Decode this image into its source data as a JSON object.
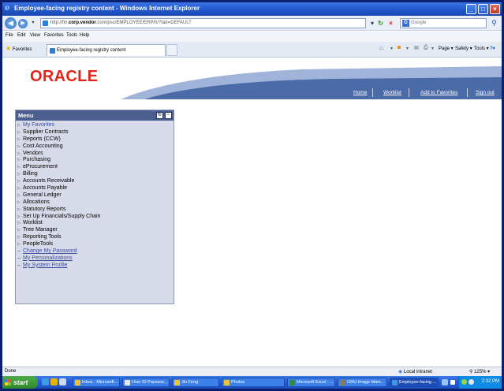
{
  "window": {
    "title": "Employee-facing registry content - Windows Internet Explorer"
  },
  "address": {
    "url_prefix": "http://fin.",
    "url_domain": "corp.vendor",
    "url_suffix": ".com/psc/EMPLOYEE/ERP/h/?tab=DEFAULT",
    "search_placeholder": "Google"
  },
  "menubar": {
    "items": [
      "File",
      "Edit",
      "View",
      "Favorites",
      "Tools",
      "Help"
    ]
  },
  "favorites": {
    "favorites_label": "Favorites",
    "tab_title": "Employee-facing registry content",
    "page_label": "Page",
    "safety_label": "Safety",
    "tools_label": "Tools"
  },
  "header": {
    "logo": "ORACLE",
    "links": [
      "Home",
      "Worklist",
      "Add to Favorites",
      "Sign out"
    ]
  },
  "menu": {
    "title": "Menu",
    "items": [
      {
        "label": "My Favorites",
        "kind": "fav"
      },
      {
        "label": "Supplier Contracts",
        "kind": "folder"
      },
      {
        "label": "Reports (CCW)",
        "kind": "folder"
      },
      {
        "label": "Cost Accounting",
        "kind": "folder"
      },
      {
        "label": "Vendors",
        "kind": "folder"
      },
      {
        "label": "Purchasing",
        "kind": "folder"
      },
      {
        "label": "eProcurement",
        "kind": "folder"
      },
      {
        "label": "Billing",
        "kind": "folder"
      },
      {
        "label": "Accounts Receivable",
        "kind": "folder"
      },
      {
        "label": "Accounts Payable",
        "kind": "folder"
      },
      {
        "label": "General Ledger",
        "kind": "folder"
      },
      {
        "label": "Allocations",
        "kind": "folder"
      },
      {
        "label": "Statutory Reports",
        "kind": "folder"
      },
      {
        "label": "Set Up Financials/Supply Chain",
        "kind": "folder"
      },
      {
        "label": "Worklist",
        "kind": "folder"
      },
      {
        "label": "Tree Manager",
        "kind": "folder"
      },
      {
        "label": "Reporting Tools",
        "kind": "folder"
      },
      {
        "label": "PeopleTools",
        "kind": "folder"
      },
      {
        "label": "Change My Password",
        "kind": "link"
      },
      {
        "label": "My Personalizations",
        "kind": "link"
      },
      {
        "label": "My System Profile",
        "kind": "link"
      }
    ]
  },
  "status": {
    "text": "Done",
    "zone": "Local intranet",
    "zoom": "125%"
  },
  "taskbar": {
    "start": "start",
    "buttons": [
      "Inbox - Microsoft...",
      "User ID Passwor...",
      "Jin Feng",
      "Photos",
      "Microsoft Excel - ...",
      "GNU Image Mani...",
      "Employee-facing ..."
    ],
    "clock": "2:32 PM"
  },
  "colors": {
    "brand_red": "#e0261b",
    "header_blue": "#4a6aa8",
    "menu_header": "#4a5f8f",
    "menu_bg": "#d7dbe9",
    "link_blue": "#3b4fa0"
  }
}
